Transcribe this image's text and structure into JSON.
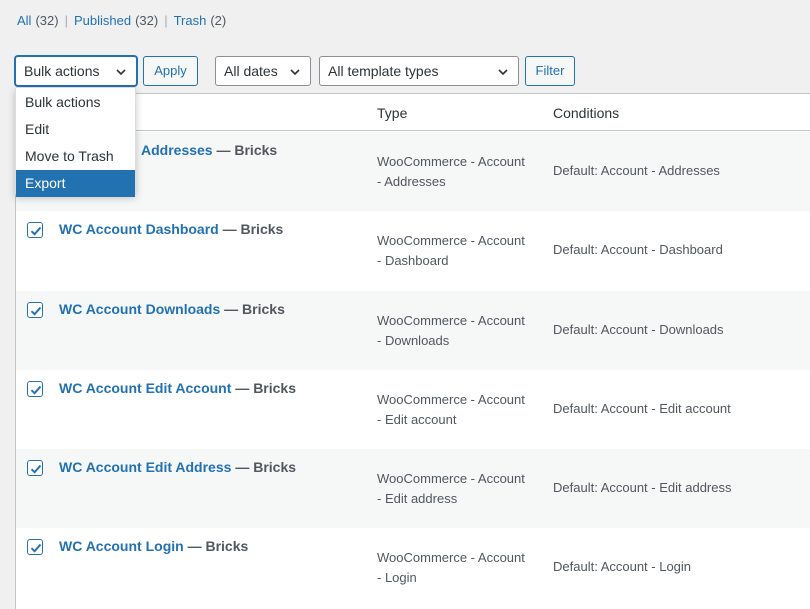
{
  "filters": {
    "all": {
      "label": "All",
      "count": "(32)"
    },
    "published": {
      "label": "Published",
      "count": "(32)"
    },
    "trash": {
      "label": "Trash",
      "count": "(2)"
    },
    "separator": "|"
  },
  "toolbar": {
    "bulk_actions": "Bulk actions",
    "apply": "Apply",
    "dates": "All dates",
    "template_types": "All template types",
    "filter": "Filter"
  },
  "bulk_menu": {
    "options": [
      "Bulk actions",
      "Edit",
      "Move to Trash",
      "Export"
    ],
    "highlighted": "Export"
  },
  "table": {
    "columns": {
      "type": "Type",
      "conditions": "Conditions"
    },
    "rows": [
      {
        "title": "WC Account Addresses",
        "partial_title": "Addresses",
        "builder": "Bricks",
        "type_line1": "WooCommerce - Account",
        "type_line2": "- Addresses",
        "condition": "Default: Account - Addresses",
        "checked": true
      },
      {
        "title": "WC Account Dashboard",
        "builder": "Bricks",
        "type_line1": "WooCommerce - Account",
        "type_line2": "- Dashboard",
        "condition": "Default: Account - Dashboard",
        "checked": true
      },
      {
        "title": "WC Account Downloads",
        "builder": "Bricks",
        "type_line1": "WooCommerce - Account",
        "type_line2": "- Downloads",
        "condition": "Default: Account - Downloads",
        "checked": true
      },
      {
        "title": "WC Account Edit Account",
        "builder": "Bricks",
        "type_line1": "WooCommerce - Account",
        "type_line2": "- Edit account",
        "condition": "Default: Account - Edit account",
        "checked": true
      },
      {
        "title": "WC Account Edit Address",
        "builder": "Bricks",
        "type_line1": "WooCommerce - Account",
        "type_line2": "- Edit address",
        "condition": "Default: Account - Edit address",
        "checked": true
      },
      {
        "title": "WC Account Login",
        "builder": "Bricks",
        "type_line1": "WooCommerce - Account",
        "type_line2": "- Login",
        "condition": "Default: Account - Login",
        "checked": true
      }
    ]
  },
  "colors": {
    "accent": "#2271b1",
    "background": "#f0f0f1"
  },
  "icons": {
    "dropdown": "chevron-down-icon",
    "checkbox": "checkmark-icon"
  }
}
